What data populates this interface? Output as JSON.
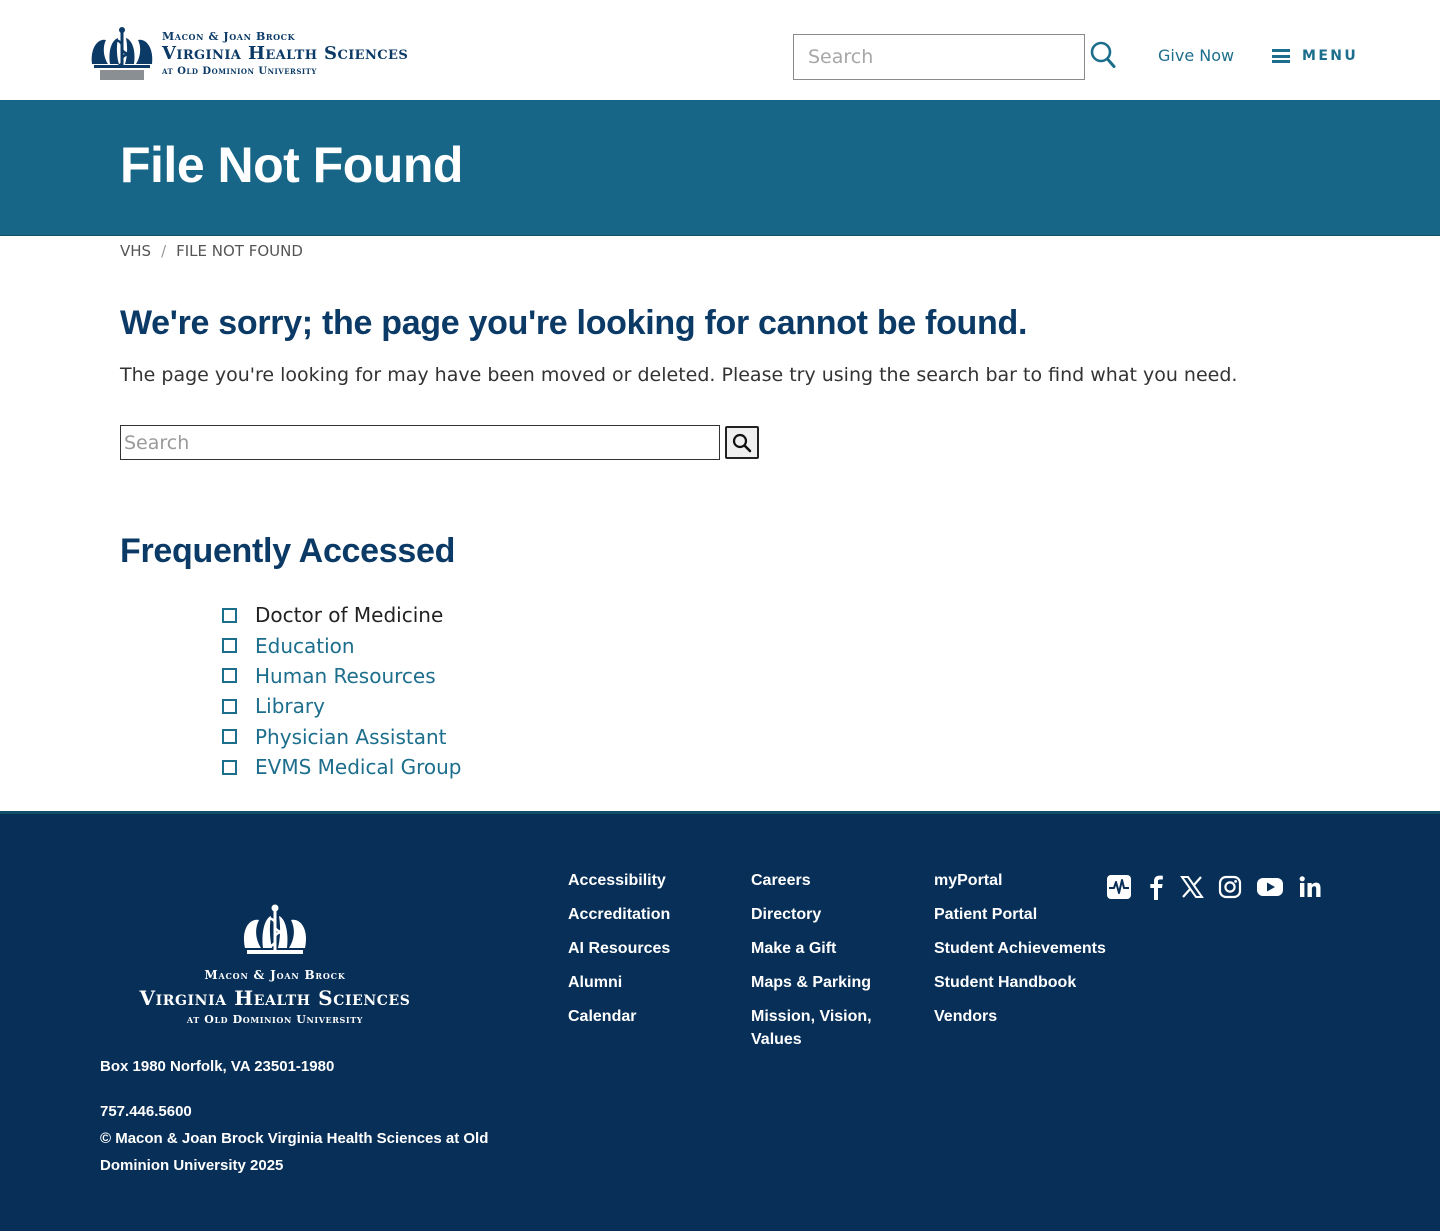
{
  "header": {
    "logo": {
      "line1": "Macon & Joan Brock",
      "line2": "Virginia Health Sciences",
      "line3": "at Old Dominion University"
    },
    "search_placeholder": "Search",
    "give_now": "Give Now",
    "menu_label": "MENU"
  },
  "banner": {
    "title": "File Not Found"
  },
  "breadcrumb": [
    {
      "label": "VHS"
    },
    {
      "label": "FILE NOT FOUND"
    }
  ],
  "main": {
    "heading": "We're sorry; the page you're looking for cannot be found.",
    "lead": "The page you're looking for may have been moved or deleted. Please try using the search bar to find what you need.",
    "search_placeholder": "Search",
    "frequently_title": "Frequently Accessed",
    "frequently_links": [
      "Doctor of Medicine",
      "Education",
      "Human Resources",
      "Library",
      "Physician Assistant",
      "EVMS Medical Group"
    ]
  },
  "footer": {
    "logo": {
      "line1": "Macon & Joan Brock",
      "line2": "Virginia Health Sciences",
      "line3": "at Old Dominion University"
    },
    "address": "Box 1980 Norfolk, VA 23501-1980",
    "phone": "757.446.5600",
    "copyright": "© Macon & Joan Brock Virginia Health Sciences at Old Dominion University 2025",
    "col1": [
      "Accessibility",
      "Accreditation",
      "AI Resources",
      "Alumni",
      "Calendar"
    ],
    "col2": [
      "Careers",
      "Directory",
      "Make a Gift",
      "Maps & Parking",
      "Mission, Vision, Values"
    ],
    "col3": [
      "myPortal",
      "Patient Portal",
      "Student Achievements",
      "Student Handbook",
      "Vendors"
    ],
    "social_icons": [
      "health-pulse-icon",
      "facebook-icon",
      "x-icon",
      "instagram-icon",
      "youtube-icon",
      "linkedin-icon"
    ]
  },
  "colors": {
    "brand_navy": "#0b3a66",
    "banner_teal": "#176687",
    "link_teal": "#1c6e8c",
    "footer_navy": "#072f57"
  }
}
